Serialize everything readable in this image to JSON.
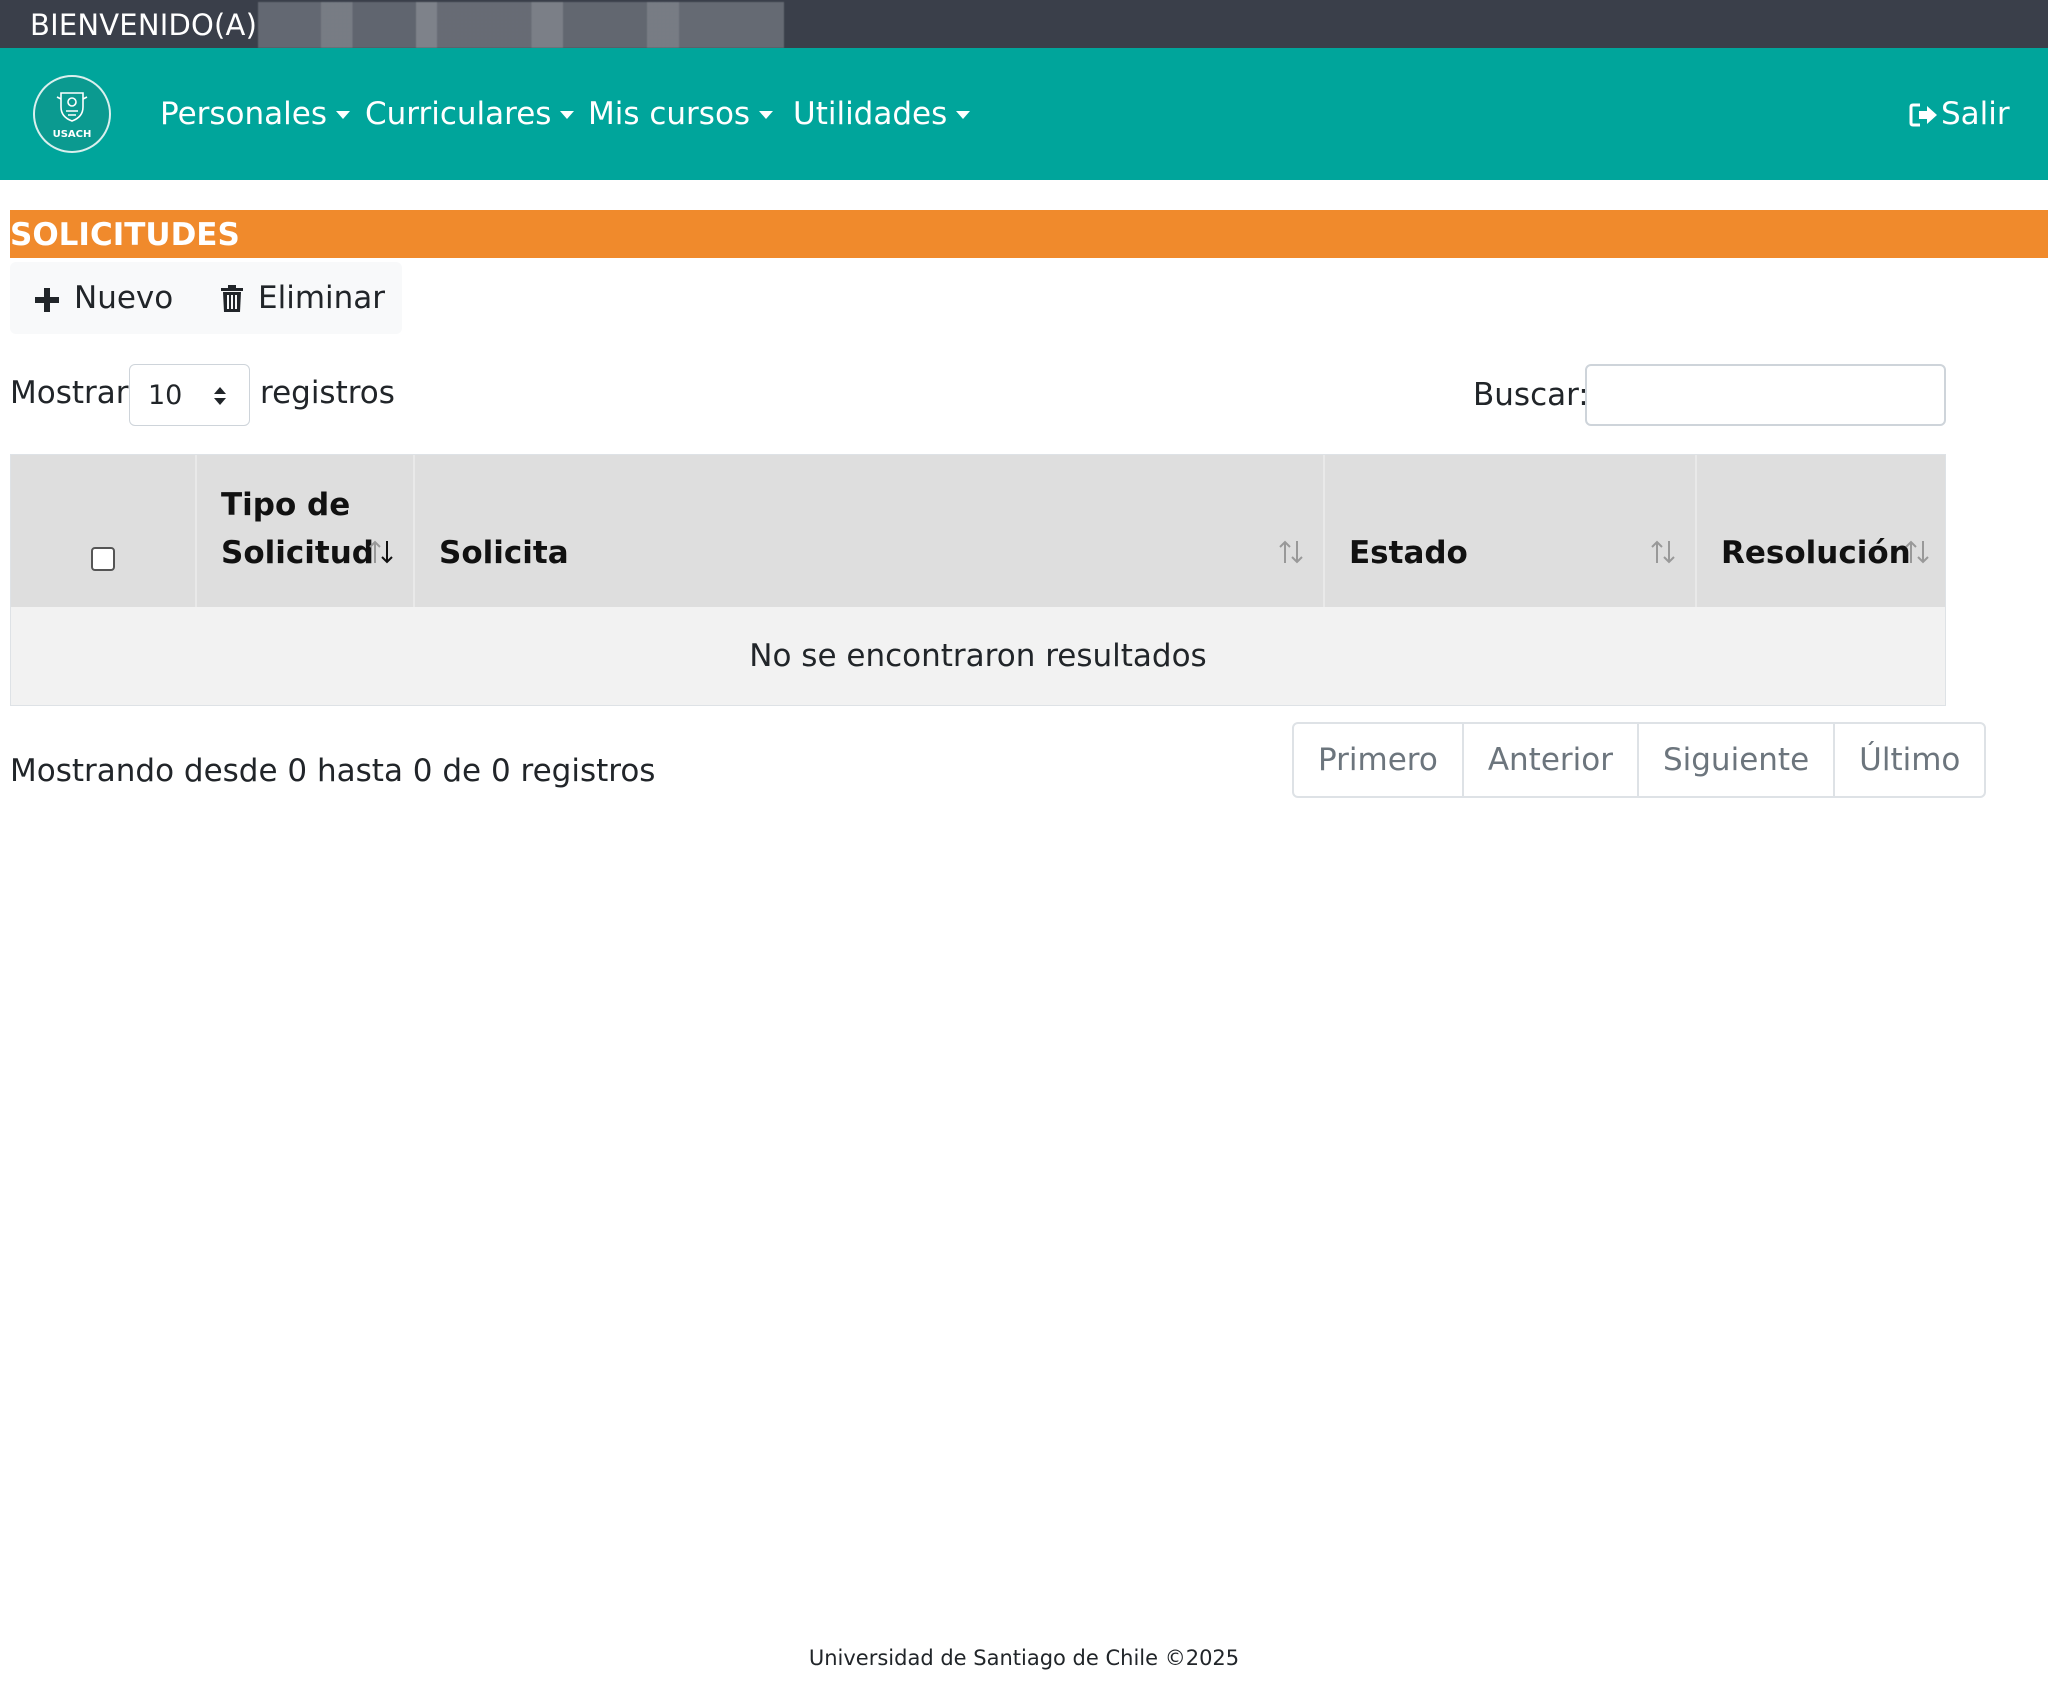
{
  "welcome": {
    "label": "BIENVENIDO(A)"
  },
  "nav": {
    "logo_text": "USACH",
    "items": [
      {
        "label": "Personales"
      },
      {
        "label": "Curriculares"
      },
      {
        "label": "Mis cursos"
      },
      {
        "label": "Utilidades"
      }
    ],
    "logout_label": "Salir"
  },
  "section": {
    "title": "SOLICITUDES"
  },
  "toolbar": {
    "new_label": "Nuevo",
    "delete_label": "Eliminar"
  },
  "table_controls": {
    "show_label": "Mostrar",
    "page_size": "10",
    "records_label": "registros",
    "search_label": "Buscar:",
    "search_value": ""
  },
  "table": {
    "columns": [
      {
        "label": ""
      },
      {
        "label": "Tipo de Solicitud"
      },
      {
        "label": "Solicita"
      },
      {
        "label": "Estado"
      },
      {
        "label": "Resolución"
      }
    ],
    "empty_message": "No se encontraron resultados"
  },
  "pagination": {
    "info": "Mostrando desde 0 hasta 0 de 0 registros",
    "first": "Primero",
    "previous": "Anterior",
    "next": "Siguiente",
    "last": "Último"
  },
  "footer": {
    "text": "Universidad de Santiago de Chile ©2025"
  },
  "colors": {
    "welcome_bar": "#3a3f4a",
    "navbar": "#00a59b",
    "section_bar": "#f08a2c"
  }
}
